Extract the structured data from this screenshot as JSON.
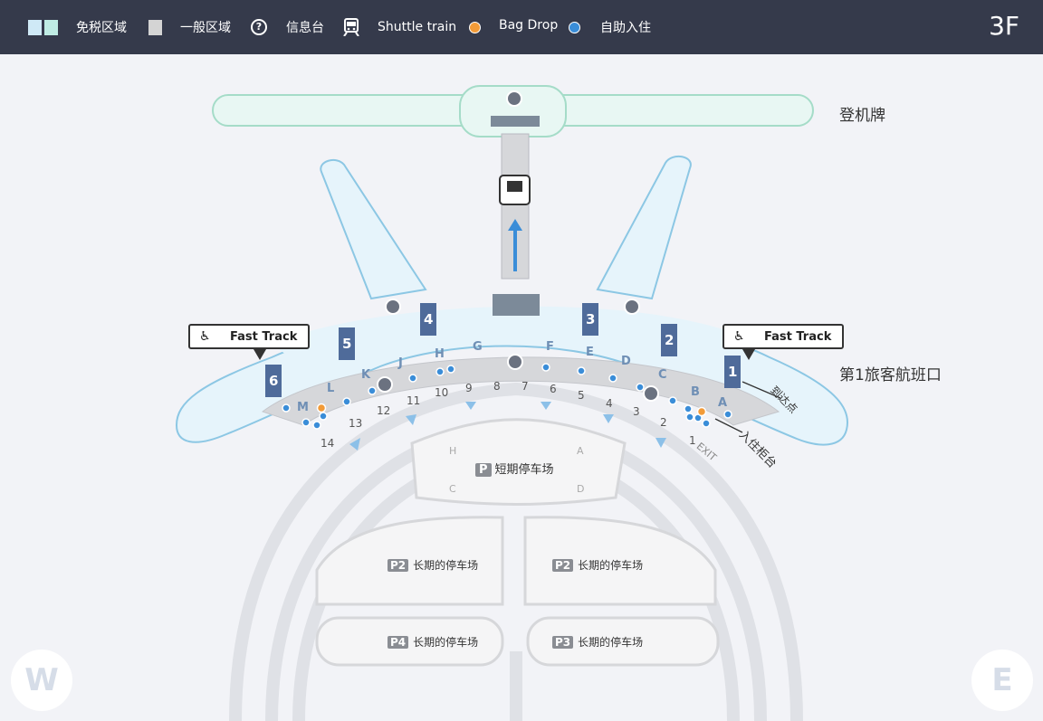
{
  "legend": {
    "duty_free": "免税区域",
    "general": "一般区域",
    "info": "信息台",
    "shuttle": "Shuttle train",
    "bag_drop": "Bag Drop",
    "self_checkin": "自助入住",
    "info_glyph": "?",
    "shuttle_icon": "train-icon"
  },
  "floor": "3F",
  "colors": {
    "topbar": "#353a4b",
    "zone": "#e6f4fb",
    "zone_border": "#8cc7e4",
    "general": "#d6d7da",
    "pillar": "#4f6b9a",
    "self_dot": "#3a8dd8",
    "bag_dot": "#f29b38",
    "arrow": "#3a8dd8"
  },
  "map": {
    "boarding_label": "登机牌",
    "terminal_label": "第1旅客航班口",
    "arrival_label": "到达点",
    "checkin_label": "入住柜台",
    "exit_label": "EXIT",
    "fast_track": "Fast Track",
    "islands": [
      {
        "num": "1",
        "letter": "A"
      },
      {
        "num": "2",
        "letter": "B"
      },
      {
        "num": "3",
        "letter": "C"
      },
      {
        "num": "4",
        "letter": "D"
      },
      {
        "num": "5",
        "letter": "E"
      },
      {
        "num": "6",
        "letter": "F"
      },
      {
        "num": "7",
        "letter": "G"
      },
      {
        "num": "8",
        "letter": "H"
      },
      {
        "num": "9",
        "letter": "J"
      },
      {
        "num": "10",
        "letter": "K"
      },
      {
        "num": "11",
        "letter": "L"
      },
      {
        "num": "12",
        "letter": "M"
      },
      {
        "num": "13",
        "letter": ""
      },
      {
        "num": "14",
        "letter": ""
      }
    ],
    "pillars": [
      "1",
      "2",
      "3",
      "4",
      "5",
      "6"
    ],
    "parking": {
      "short": {
        "badge": "P",
        "text": "短期停车场",
        "zones": [
          "H",
          "A",
          "C",
          "D"
        ]
      },
      "p2": {
        "badge": "P2",
        "text": "长期的停车场"
      },
      "p3": {
        "badge": "P3",
        "text": "长期的停车场"
      },
      "p4": {
        "badge": "P4",
        "text": "长期的停车场"
      }
    },
    "compass_w": "W",
    "compass_e": "E"
  }
}
